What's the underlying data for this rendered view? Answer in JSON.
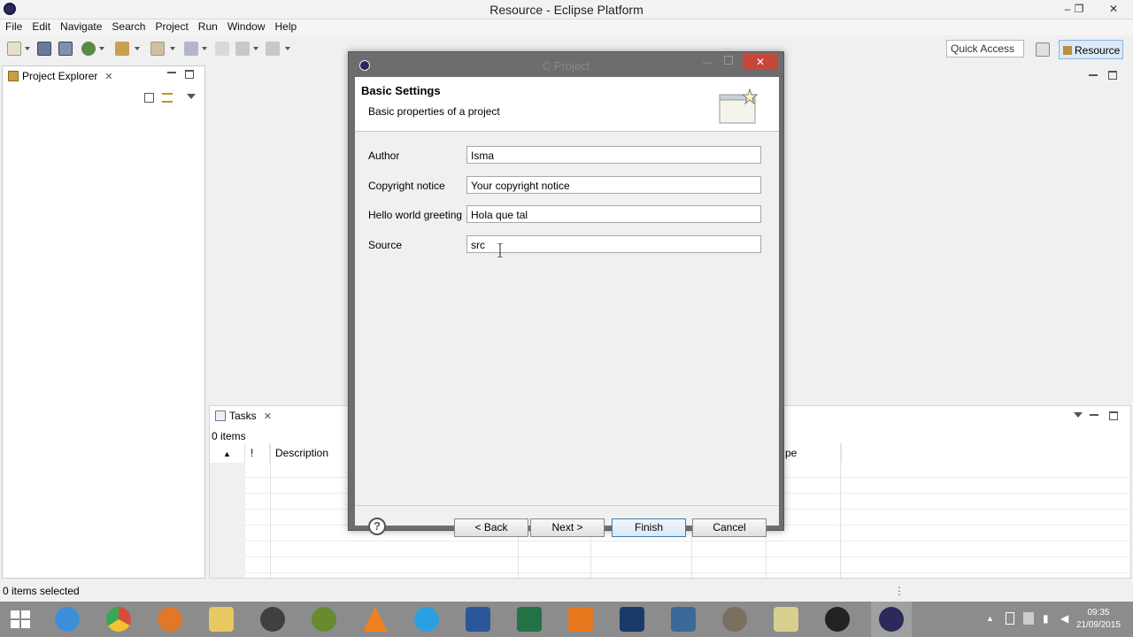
{
  "window": {
    "title": "Resource - Eclipse Platform",
    "controls": {
      "minimize": "–",
      "restore": "❐",
      "close": "✕"
    }
  },
  "menubar": [
    "File",
    "Edit",
    "Navigate",
    "Search",
    "Project",
    "Run",
    "Window",
    "Help"
  ],
  "toolbar": {
    "quick_access": "Quick Access",
    "perspective": "Resource"
  },
  "project_explorer": {
    "tab_label": "Project Explorer",
    "close": "✕"
  },
  "tasks": {
    "tab_label": "Tasks",
    "close": "✕",
    "count": "0 items",
    "columns": [
      "!",
      "Description",
      "pe"
    ]
  },
  "statusbar": {
    "text": "0 items selected"
  },
  "taskbar": {
    "time": "09:35",
    "date": "21/09/2015"
  },
  "dialog": {
    "title": "C Project",
    "close": "✕",
    "header_title": "Basic Settings",
    "header_subtitle": "Basic properties of a project",
    "fields": [
      {
        "label": "Author",
        "value": "Isma"
      },
      {
        "label": "Copyright notice",
        "value": "Your copyright notice"
      },
      {
        "label": "Hello world greeting",
        "value": "Hola que tal"
      },
      {
        "label": "Source",
        "value": "src"
      }
    ],
    "help": "?",
    "buttons": {
      "back": "< Back",
      "next": "Next >",
      "finish": "Finish",
      "cancel": "Cancel"
    }
  },
  "colors": {
    "close_red": "#c7463a",
    "perspective_blue": "#dce9f6",
    "taskbar": "#8c8c8c"
  },
  "icons": [
    "eclipse-icon",
    "new-icon",
    "save-icon",
    "debug-icon",
    "run-icon",
    "collapse-all-icon",
    "link-editor-icon",
    "view-menu-icon",
    "wizard-banner-icon",
    "windows-start-icon"
  ]
}
